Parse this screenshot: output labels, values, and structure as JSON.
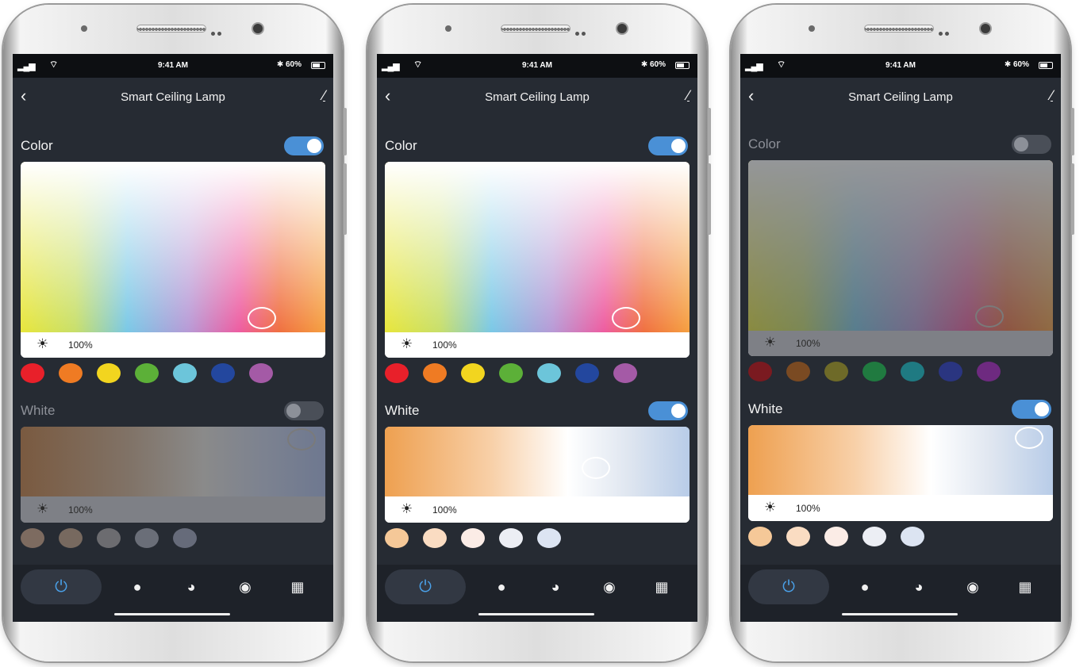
{
  "phones": [
    {
      "status": {
        "time": "9:41 AM",
        "battery": "60%"
      },
      "title": "Smart Ceiling Lamp",
      "color_section": {
        "label": "Color",
        "enabled": true,
        "brightness": "100%"
      },
      "white_section": {
        "label": "White",
        "enabled": false,
        "brightness": "100%"
      }
    },
    {
      "status": {
        "time": "9:41 AM",
        "battery": "60%"
      },
      "title": "Smart Ceiling Lamp",
      "color_section": {
        "label": "Color",
        "enabled": true,
        "brightness": "100%"
      },
      "white_section": {
        "label": "White",
        "enabled": true,
        "brightness": "100%"
      }
    },
    {
      "status": {
        "time": "9:41 AM",
        "battery": "60%"
      },
      "title": "Smart Ceiling Lamp",
      "color_section": {
        "label": "Color",
        "enabled": false,
        "brightness": "100%"
      },
      "white_section": {
        "label": "White",
        "enabled": true,
        "brightness": "100%"
      }
    }
  ],
  "color_swatches": [
    "#e8202a",
    "#ef7b23",
    "#f2d51f",
    "#5cb038",
    "#6cc5da",
    "#23479e",
    "#a45aa6"
  ],
  "color_swatches_dim": [
    "#7a1a20",
    "#7a4a22",
    "#6e6a28",
    "#207a40",
    "#1f7a82",
    "#2a3580",
    "#6e2a80"
  ],
  "white_swatches": [
    "#f5c898",
    "#fadcc2",
    "#fbece6",
    "#eceef4",
    "#dce4f2"
  ],
  "white_swatches_dim": [
    "#7d6b60",
    "#77695f",
    "#6c6c70",
    "#6a6e78",
    "#666b7a"
  ],
  "icons": {
    "back": "back-arrow-icon",
    "edit": "edit-pencil-icon",
    "power": "power-icon",
    "bulb": "bulb-icon",
    "palette": "palette-icon",
    "scene": "scene-icon",
    "grid": "grid-icon",
    "sun": "sun-icon"
  }
}
